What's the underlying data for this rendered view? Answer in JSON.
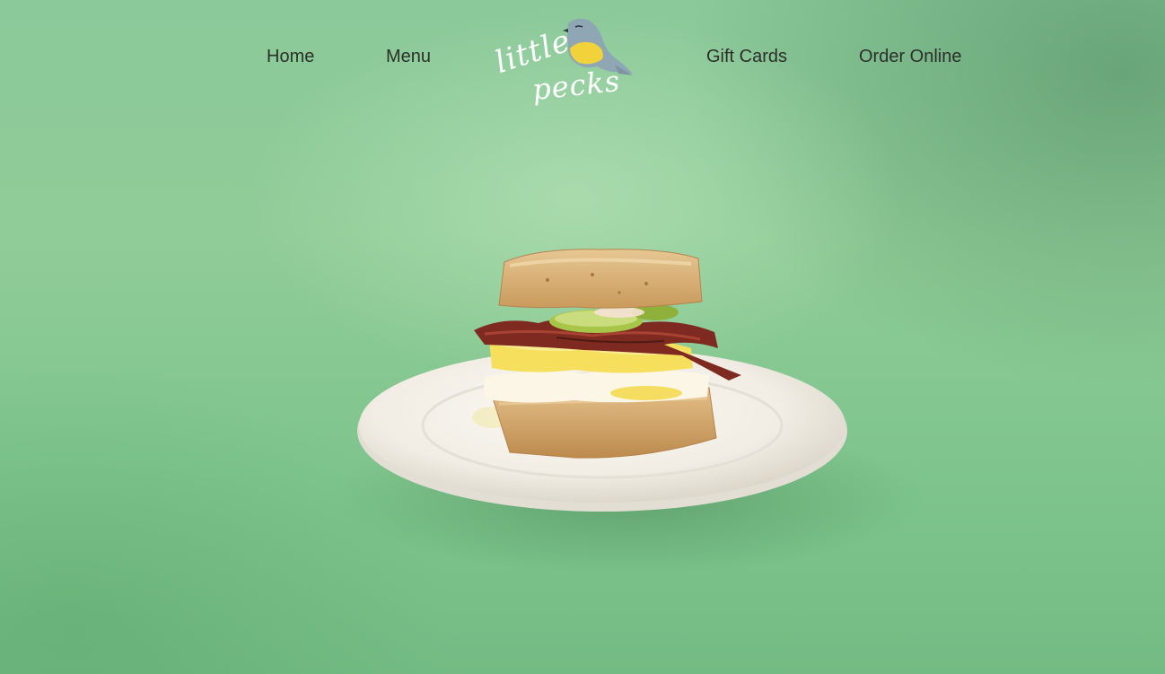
{
  "nav": {
    "items": [
      {
        "label": "Home"
      },
      {
        "label": "Menu"
      },
      {
        "label": "Gift Cards"
      },
      {
        "label": "Order Online"
      }
    ],
    "logo_text": [
      "little",
      "pecks"
    ]
  },
  "hero": {
    "image_subject": "biscuit-breakfast-sandwich-on-plate",
    "colors": {
      "background": "#8bc99a",
      "plate": "#f4f1ea",
      "biscuit": "#d9b27a",
      "egg_yolk": "#f5d64a",
      "bacon": "#8a2f24",
      "pickle": "#9cbf3c"
    }
  },
  "colors": {
    "nav_text": "#2c2f2a",
    "logo_bird_body": "#8fa7b5",
    "logo_bird_belly": "#f2d23a",
    "logo_text": "#ffffff"
  }
}
